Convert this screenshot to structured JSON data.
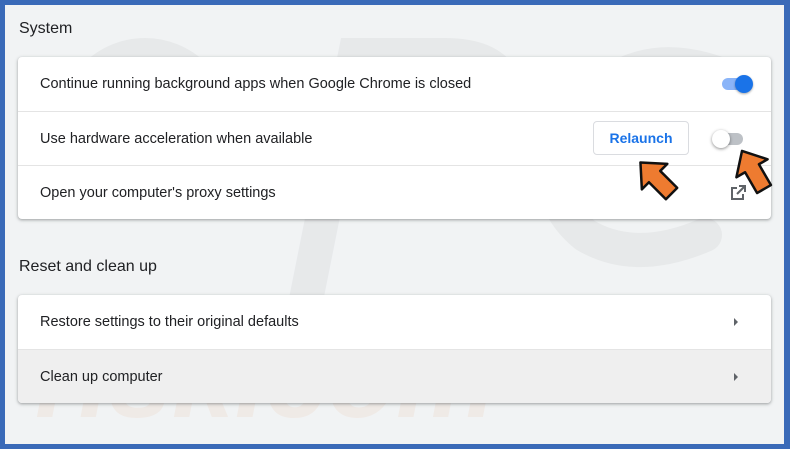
{
  "sections": {
    "system": {
      "title": "System",
      "rows": [
        {
          "label": "Continue running background apps when Google Chrome is closed",
          "control": "toggle",
          "enabled": true
        },
        {
          "label": "Use hardware acceleration when available",
          "control": "toggle",
          "enabled": false,
          "button_label": "Relaunch"
        },
        {
          "label": "Open your computer's proxy settings",
          "control": "external-link-icon"
        }
      ]
    },
    "reset": {
      "title": "Reset and clean up",
      "rows": [
        {
          "label": "Restore settings to their original defaults",
          "control": "chevron-right-icon"
        },
        {
          "label": "Clean up computer",
          "control": "chevron-right-icon",
          "highlighted": true
        }
      ]
    }
  },
  "watermark": {
    "top_text": "PC",
    "bottom_text": "risk.com"
  },
  "colors": {
    "accent": "#1a73e8",
    "toggle_on_track": "#8ab4f8",
    "toggle_off_track": "#bdc1c6",
    "annotation_arrow": "#ee7b30",
    "frame_border": "#3a6ab8",
    "page_background": "#f1f3f4"
  }
}
